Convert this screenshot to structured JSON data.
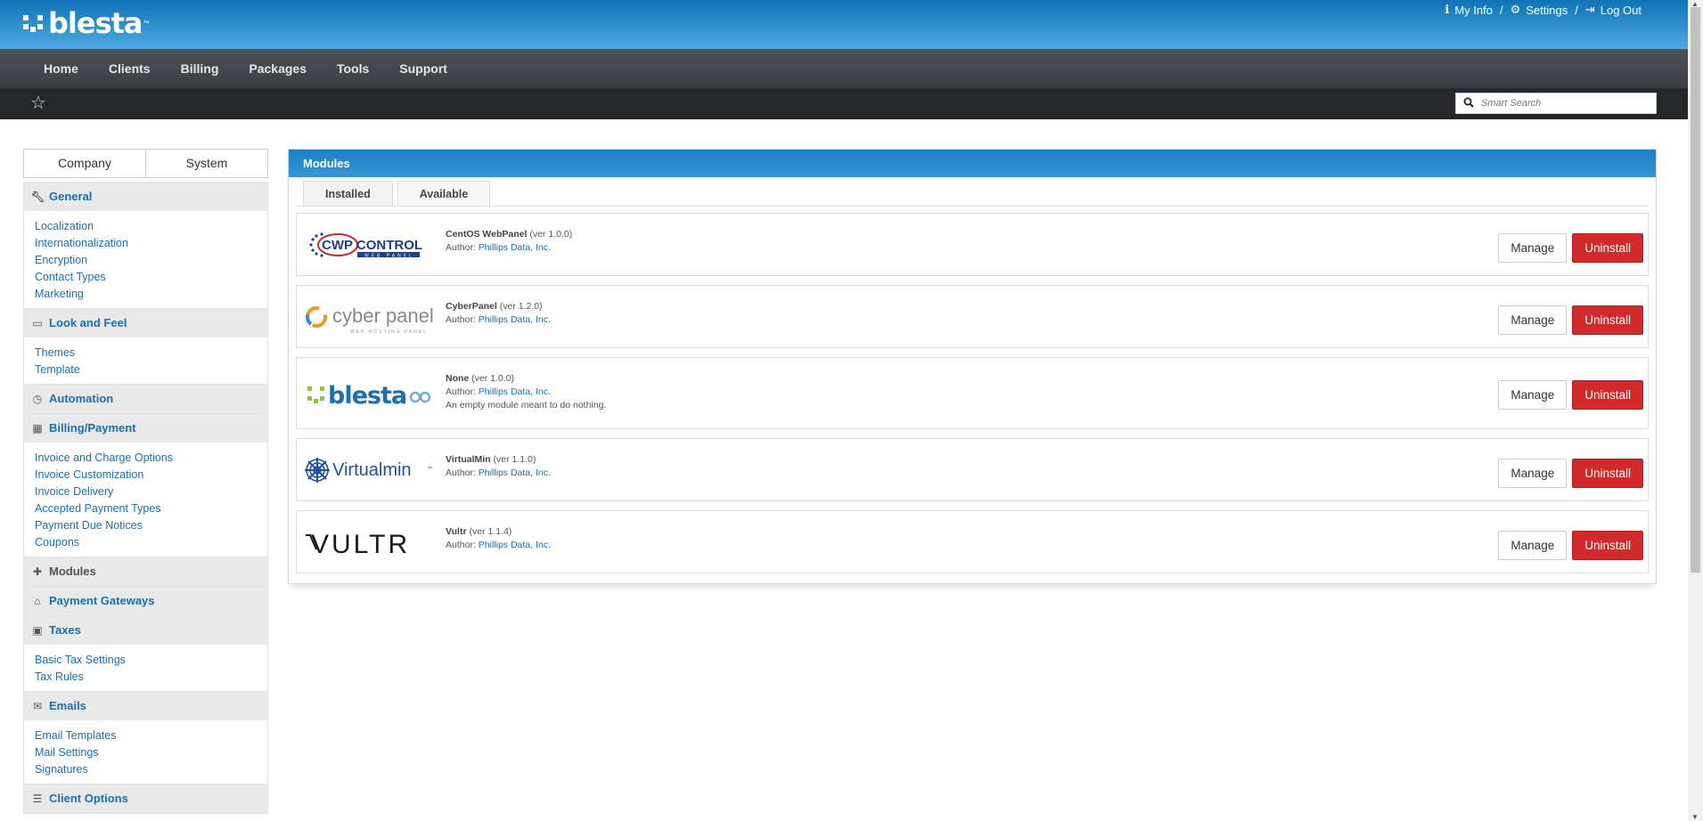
{
  "header": {
    "logo_text": "blesta",
    "logo_tm": "™",
    "links": [
      "My Info",
      "Settings",
      "Log Out"
    ]
  },
  "nav": [
    "Home",
    "Clients",
    "Billing",
    "Packages",
    "Tools",
    "Support"
  ],
  "search": {
    "placeholder": "Smart Search"
  },
  "sidebar": {
    "tabs": [
      "Company",
      "System"
    ],
    "sections": [
      {
        "label": "General",
        "icon": "wrench-icon",
        "links": [
          "Localization",
          "Internationalization",
          "Encryption",
          "Contact Types",
          "Marketing"
        ]
      },
      {
        "label": "Look and Feel",
        "icon": "monitor-icon",
        "links": [
          "Themes",
          "Template"
        ]
      },
      {
        "label": "Automation",
        "icon": "clock-icon",
        "links": []
      },
      {
        "label": "Billing/Payment",
        "icon": "calculator-icon",
        "links": [
          "Invoice and Charge Options",
          "Invoice Customization",
          "Invoice Delivery",
          "Accepted Payment Types",
          "Payment Due Notices",
          "Coupons"
        ]
      },
      {
        "label": "Modules",
        "icon": "puzzle-icon",
        "links": []
      },
      {
        "label": "Payment Gateways",
        "icon": "bank-icon",
        "links": []
      },
      {
        "label": "Taxes",
        "icon": "money-icon",
        "links": [
          "Basic Tax Settings",
          "Tax Rules"
        ]
      },
      {
        "label": "Emails",
        "icon": "envelope-icon",
        "links": [
          "Email Templates",
          "Mail Settings",
          "Signatures"
        ]
      },
      {
        "label": "Client Options",
        "icon": "sliders-icon",
        "links": []
      }
    ]
  },
  "panel": {
    "title": "Modules",
    "tabs": [
      "Installed",
      "Available"
    ],
    "author_label": "Author:",
    "manage_label": "Manage",
    "uninstall_label": "Uninstall",
    "modules": [
      {
        "name": "CentOS WebPanel",
        "version": "(ver 1.0.0)",
        "author": "Phillips Data, Inc.",
        "description": "",
        "logo": "CWP CONTROL",
        "logo_sub": "WEB PANEL"
      },
      {
        "name": "CyberPanel",
        "version": "(ver 1.2.0)",
        "author": "Phillips Data, Inc.",
        "description": "",
        "logo": "cyber panel",
        "logo_sub": "WEB HOSTING PANEL"
      },
      {
        "name": "None",
        "version": "(ver 1.0.0)",
        "author": "Phillips Data, Inc.",
        "description": "An empty module meant to do nothing.",
        "logo": "blesta",
        "logo_sub": ""
      },
      {
        "name": "VirtualMin",
        "version": "(ver 1.1.0)",
        "author": "Phillips Data, Inc.",
        "description": "",
        "logo": "Virtualmin",
        "logo_sub": ""
      },
      {
        "name": "Vultr",
        "version": "(ver 1.1.4)",
        "author": "Phillips Data, Inc.",
        "description": "",
        "logo": "VULTR",
        "logo_sub": ""
      }
    ]
  },
  "colors": {
    "brand_blue": "#1a7cc1",
    "nav_dark": "#3b3f44",
    "danger": "#d22a2a",
    "link": "#1a6fb5"
  }
}
